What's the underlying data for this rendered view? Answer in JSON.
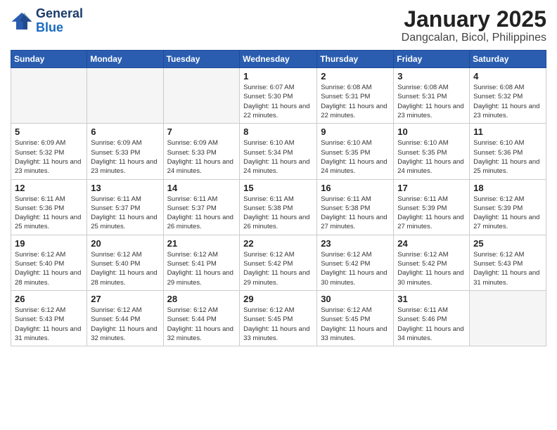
{
  "logo": {
    "line1": "General",
    "line2": "Blue"
  },
  "title": "January 2025",
  "subtitle": "Dangcalan, Bicol, Philippines",
  "weekdays": [
    "Sunday",
    "Monday",
    "Tuesday",
    "Wednesday",
    "Thursday",
    "Friday",
    "Saturday"
  ],
  "weeks": [
    [
      {
        "day": "",
        "info": ""
      },
      {
        "day": "",
        "info": ""
      },
      {
        "day": "",
        "info": ""
      },
      {
        "day": "1",
        "info": "Sunrise: 6:07 AM\nSunset: 5:30 PM\nDaylight: 11 hours and 22 minutes."
      },
      {
        "day": "2",
        "info": "Sunrise: 6:08 AM\nSunset: 5:31 PM\nDaylight: 11 hours and 22 minutes."
      },
      {
        "day": "3",
        "info": "Sunrise: 6:08 AM\nSunset: 5:31 PM\nDaylight: 11 hours and 23 minutes."
      },
      {
        "day": "4",
        "info": "Sunrise: 6:08 AM\nSunset: 5:32 PM\nDaylight: 11 hours and 23 minutes."
      }
    ],
    [
      {
        "day": "5",
        "info": "Sunrise: 6:09 AM\nSunset: 5:32 PM\nDaylight: 11 hours and 23 minutes."
      },
      {
        "day": "6",
        "info": "Sunrise: 6:09 AM\nSunset: 5:33 PM\nDaylight: 11 hours and 23 minutes."
      },
      {
        "day": "7",
        "info": "Sunrise: 6:09 AM\nSunset: 5:33 PM\nDaylight: 11 hours and 24 minutes."
      },
      {
        "day": "8",
        "info": "Sunrise: 6:10 AM\nSunset: 5:34 PM\nDaylight: 11 hours and 24 minutes."
      },
      {
        "day": "9",
        "info": "Sunrise: 6:10 AM\nSunset: 5:35 PM\nDaylight: 11 hours and 24 minutes."
      },
      {
        "day": "10",
        "info": "Sunrise: 6:10 AM\nSunset: 5:35 PM\nDaylight: 11 hours and 24 minutes."
      },
      {
        "day": "11",
        "info": "Sunrise: 6:10 AM\nSunset: 5:36 PM\nDaylight: 11 hours and 25 minutes."
      }
    ],
    [
      {
        "day": "12",
        "info": "Sunrise: 6:11 AM\nSunset: 5:36 PM\nDaylight: 11 hours and 25 minutes."
      },
      {
        "day": "13",
        "info": "Sunrise: 6:11 AM\nSunset: 5:37 PM\nDaylight: 11 hours and 25 minutes."
      },
      {
        "day": "14",
        "info": "Sunrise: 6:11 AM\nSunset: 5:37 PM\nDaylight: 11 hours and 26 minutes."
      },
      {
        "day": "15",
        "info": "Sunrise: 6:11 AM\nSunset: 5:38 PM\nDaylight: 11 hours and 26 minutes."
      },
      {
        "day": "16",
        "info": "Sunrise: 6:11 AM\nSunset: 5:38 PM\nDaylight: 11 hours and 27 minutes."
      },
      {
        "day": "17",
        "info": "Sunrise: 6:11 AM\nSunset: 5:39 PM\nDaylight: 11 hours and 27 minutes."
      },
      {
        "day": "18",
        "info": "Sunrise: 6:12 AM\nSunset: 5:39 PM\nDaylight: 11 hours and 27 minutes."
      }
    ],
    [
      {
        "day": "19",
        "info": "Sunrise: 6:12 AM\nSunset: 5:40 PM\nDaylight: 11 hours and 28 minutes."
      },
      {
        "day": "20",
        "info": "Sunrise: 6:12 AM\nSunset: 5:40 PM\nDaylight: 11 hours and 28 minutes."
      },
      {
        "day": "21",
        "info": "Sunrise: 6:12 AM\nSunset: 5:41 PM\nDaylight: 11 hours and 29 minutes."
      },
      {
        "day": "22",
        "info": "Sunrise: 6:12 AM\nSunset: 5:42 PM\nDaylight: 11 hours and 29 minutes."
      },
      {
        "day": "23",
        "info": "Sunrise: 6:12 AM\nSunset: 5:42 PM\nDaylight: 11 hours and 30 minutes."
      },
      {
        "day": "24",
        "info": "Sunrise: 6:12 AM\nSunset: 5:42 PM\nDaylight: 11 hours and 30 minutes."
      },
      {
        "day": "25",
        "info": "Sunrise: 6:12 AM\nSunset: 5:43 PM\nDaylight: 11 hours and 31 minutes."
      }
    ],
    [
      {
        "day": "26",
        "info": "Sunrise: 6:12 AM\nSunset: 5:43 PM\nDaylight: 11 hours and 31 minutes."
      },
      {
        "day": "27",
        "info": "Sunrise: 6:12 AM\nSunset: 5:44 PM\nDaylight: 11 hours and 32 minutes."
      },
      {
        "day": "28",
        "info": "Sunrise: 6:12 AM\nSunset: 5:44 PM\nDaylight: 11 hours and 32 minutes."
      },
      {
        "day": "29",
        "info": "Sunrise: 6:12 AM\nSunset: 5:45 PM\nDaylight: 11 hours and 33 minutes."
      },
      {
        "day": "30",
        "info": "Sunrise: 6:12 AM\nSunset: 5:45 PM\nDaylight: 11 hours and 33 minutes."
      },
      {
        "day": "31",
        "info": "Sunrise: 6:11 AM\nSunset: 5:46 PM\nDaylight: 11 hours and 34 minutes."
      },
      {
        "day": "",
        "info": ""
      }
    ]
  ]
}
